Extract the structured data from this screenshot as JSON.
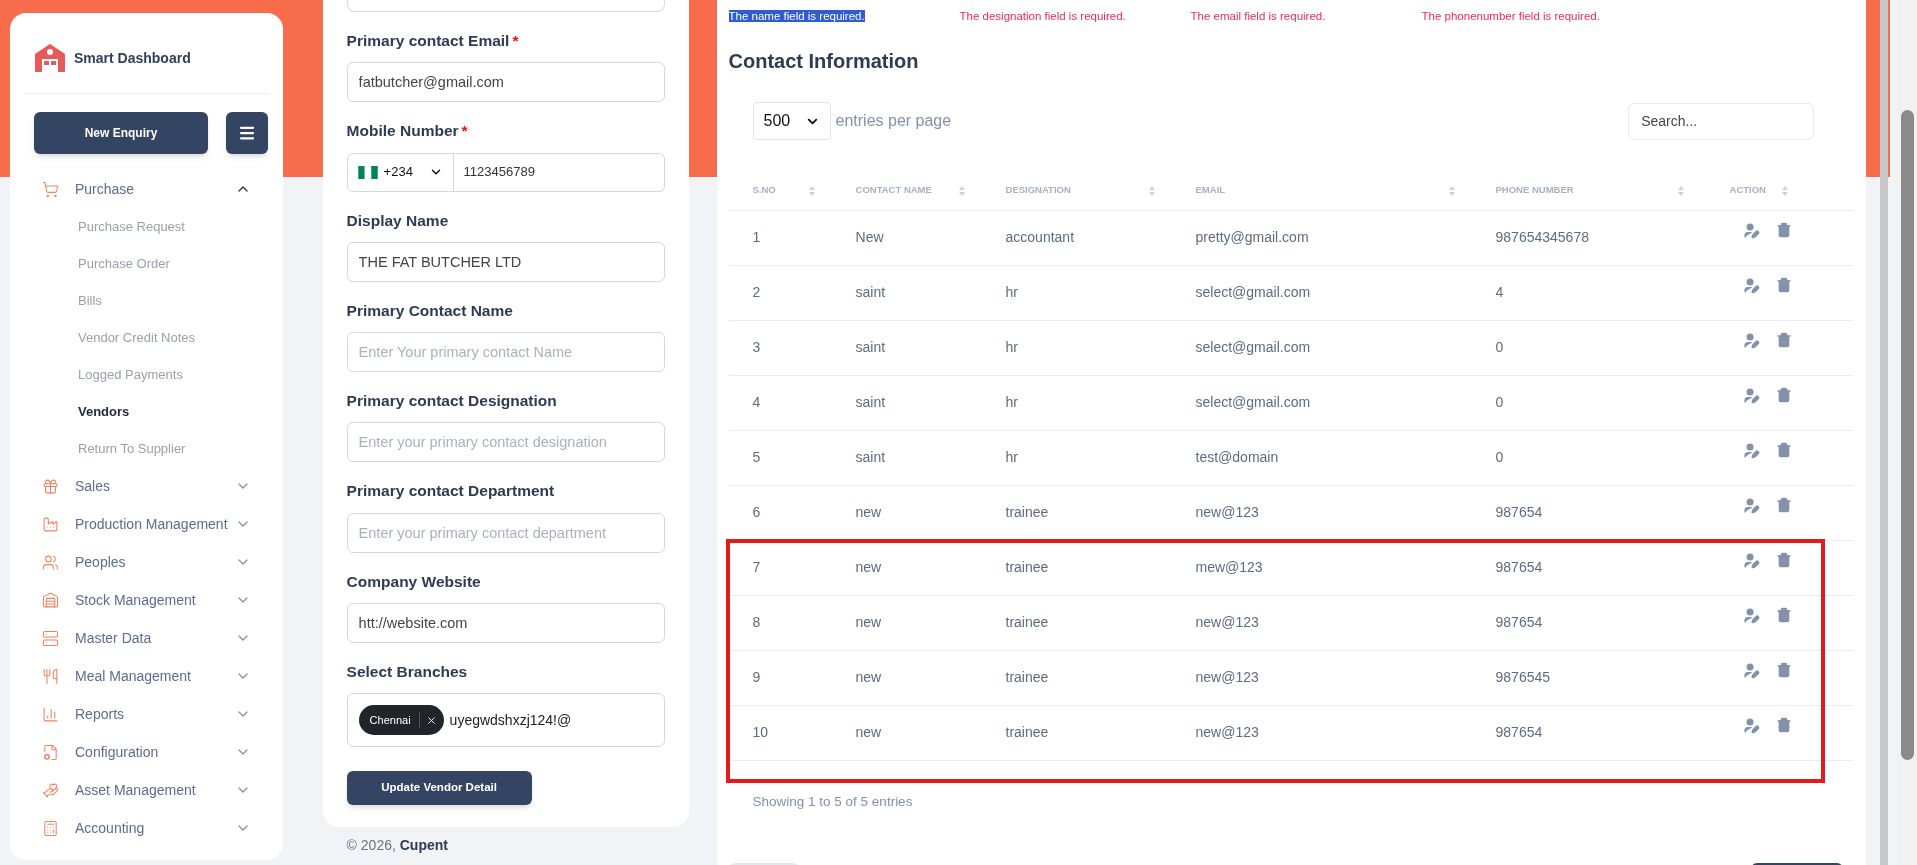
{
  "sidebar": {
    "brand": "Smart Dashboard",
    "new_button": "New Enquiry",
    "items": [
      {
        "label": "Purchase",
        "expanded": true,
        "children": [
          {
            "label": "Purchase Request",
            "selected": false
          },
          {
            "label": "Purchase Order",
            "selected": false
          },
          {
            "label": "Bills",
            "selected": false
          },
          {
            "label": "Vendor Credit Notes",
            "selected": false
          },
          {
            "label": "Logged Payments",
            "selected": false
          },
          {
            "label": "Vendors",
            "selected": true
          },
          {
            "label": "Return To Supplier",
            "selected": false
          }
        ]
      },
      {
        "label": "Sales",
        "expanded": false
      },
      {
        "label": "Production Management",
        "expanded": false
      },
      {
        "label": "Peoples",
        "expanded": false
      },
      {
        "label": "Stock Management",
        "expanded": false
      },
      {
        "label": "Master Data",
        "expanded": false
      },
      {
        "label": "Meal Management",
        "expanded": false
      },
      {
        "label": "Reports",
        "expanded": false
      },
      {
        "label": "Configuration",
        "expanded": false
      },
      {
        "label": "Asset Management",
        "expanded": false
      },
      {
        "label": "Accounting",
        "expanded": false
      }
    ]
  },
  "form": {
    "fields": [
      {
        "kind": "text",
        "label": "Primary contact Email",
        "required_mark": "*",
        "value": "fatbutcher@gmail.com"
      },
      {
        "kind": "phone",
        "label": "Mobile Number",
        "required_mark": "*",
        "country_code": "+234",
        "value": "1123456789"
      },
      {
        "kind": "text",
        "label": "Display Name",
        "value": "THE FAT BUTCHER LTD"
      },
      {
        "kind": "text",
        "label": "Primary Contact Name",
        "placeholder": "Enter Your primary contact Name"
      },
      {
        "kind": "text",
        "label": "Primary contact Designation",
        "placeholder": "Enter your primary contact designation"
      },
      {
        "kind": "text",
        "label": "Primary contact Department",
        "placeholder": "Enter your primary contact department"
      },
      {
        "kind": "text",
        "label": "Company Website",
        "value": "htt://website.com"
      },
      {
        "kind": "tags",
        "label": "Select Branches",
        "tags": [
          "Chennai"
        ],
        "value": "uyegwdshxzj124!@"
      }
    ],
    "submit": "Update Vendor Detail",
    "footer_year": "© 2026,",
    "footer_brand": "Cupent"
  },
  "errors": [
    {
      "text": "The name field is required.",
      "selected": true
    },
    {
      "text": "The designation field is required.",
      "selected": false
    },
    {
      "text": "The email field is required.",
      "selected": false
    },
    {
      "text": "The phonenumber field is required.",
      "selected": false
    }
  ],
  "contacts": {
    "title": "Contact Information",
    "page_size": "500",
    "page_size_label": "entries per page",
    "search_placeholder": "Search...",
    "columns": [
      "S.NO",
      "CONTACT NAME",
      "DESIGNATION",
      "EMAIL",
      "PHONE NUMBER",
      "ACTION"
    ],
    "rows": [
      {
        "cells": [
          "1",
          "New",
          "accountant",
          "pretty@gmail.com",
          "987654345678"
        ],
        "highlighted": false
      },
      {
        "cells": [
          "2",
          "saint",
          "hr",
          "select@gmail.com",
          "4"
        ],
        "highlighted": false
      },
      {
        "cells": [
          "3",
          "saint",
          "hr",
          "select@gmail.com",
          "0"
        ],
        "highlighted": false
      },
      {
        "cells": [
          "4",
          "saint",
          "hr",
          "select@gmail.com",
          "0"
        ],
        "highlighted": false
      },
      {
        "cells": [
          "5",
          "saint",
          "hr",
          "test@domain",
          "0"
        ],
        "highlighted": false
      },
      {
        "cells": [
          "6",
          "new",
          "trainee",
          "new@123",
          "987654"
        ],
        "highlighted": false
      },
      {
        "cells": [
          "7",
          "new",
          "trainee",
          "mew@123",
          "987654"
        ],
        "highlighted": true
      },
      {
        "cells": [
          "8",
          "new",
          "trainee",
          "new@123",
          "987654"
        ],
        "highlighted": true
      },
      {
        "cells": [
          "9",
          "new",
          "trainee",
          "new@123",
          "9876545"
        ],
        "highlighted": true
      },
      {
        "cells": [
          "10",
          "new",
          "trainee",
          "new@123",
          "987654"
        ],
        "highlighted": true
      }
    ],
    "summary": "Showing 1 to 5 of 5 entries"
  }
}
